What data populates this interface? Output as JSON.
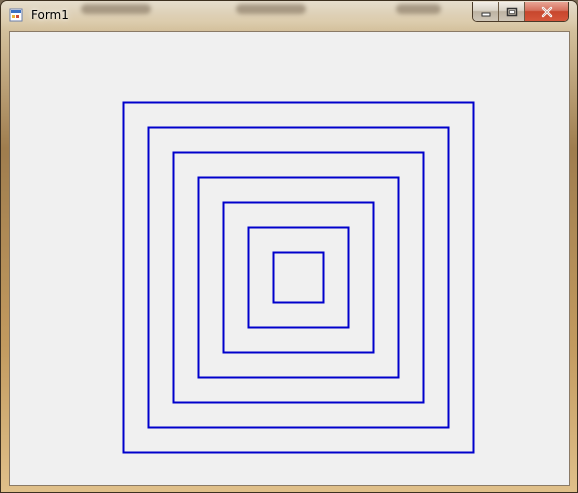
{
  "window": {
    "title": "Form1",
    "app_icon": "windows-form-icon",
    "controls": {
      "minimize_icon": "minimize-icon",
      "maximize_icon": "maximize-icon",
      "close_icon": "close-icon"
    }
  },
  "drawing": {
    "shape": "nested-squares",
    "count": 7,
    "stroke_color": "#0000cc"
  }
}
